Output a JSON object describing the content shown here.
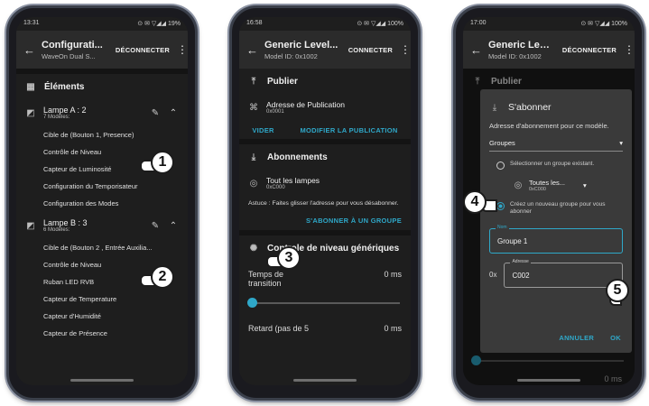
{
  "phone1": {
    "status": {
      "time": "13:31",
      "right": "⊙ ✉ ▽◢◢ 19%"
    },
    "appbar": {
      "title": "Configurati...",
      "subtitle": "WaveOn Dual S...",
      "action": "DÉCONNECTER"
    },
    "elements_title": "Éléments",
    "lampA": {
      "name": "Lampe A : 2",
      "sub": "7 Modèles:"
    },
    "lampA_items": [
      "Cible de (Bouton 1, Presence)",
      "Contrôle de Niveau",
      "Capteur de Luminosité",
      "Configuration du Temporisateur",
      "Configuration des Modes"
    ],
    "lampB": {
      "name": "Lampe B : 3",
      "sub": "6 Modèles:"
    },
    "lampB_items": [
      "Cible de (Bouton 2 , Entrée Auxilia...",
      "Contrôle de Niveau",
      "Ruban LED RVB",
      "Capteur de Temperature",
      "Capteur d'Humidité",
      "Capteur de Présence"
    ]
  },
  "phone2": {
    "status": {
      "time": "16:58",
      "right": "⊙ ✉ ▽◢◢ 100%"
    },
    "appbar": {
      "title": "Generic Level...",
      "subtitle": "Model ID: 0x1002",
      "action": "CONNECTER"
    },
    "publier": "Publier",
    "pub_addr": {
      "label": "Adresse de Publication",
      "value": "0x0001"
    },
    "vider": "VIDER",
    "modifier": "MODIFIER LA PUBLICATION",
    "abonnements": "Abonnements",
    "sub_item": {
      "label": "Tout les lampes",
      "value": "0xC000"
    },
    "astuce": "Astuce : Faites glisser l'adresse pour vous désabonner.",
    "subscribe_btn": "S'ABONNER À UN GROUPE",
    "controle": "Controle de niveau génériques",
    "temps": "Temps de transition",
    "temps_val": "0 ms",
    "retard": "Retard (pas de 5",
    "retard_val": "0 ms"
  },
  "phone3": {
    "status": {
      "time": "17:00",
      "right": "⊙ ✉ ▽◢◢ 100%"
    },
    "appbar": {
      "title": "Generic Level...",
      "subtitle": "Model ID: 0x1002",
      "action": "DÉCONNECTER"
    },
    "bg_publier": "Publier",
    "bg_val": "0 ms",
    "dialog": {
      "title": "S'abonner",
      "desc": "Adresse d'abonnement pour ce modèle.",
      "select_value": "Groupes",
      "radio1": "Sélectionner un groupe existant.",
      "group_name": "Toutes les...",
      "group_addr": "0xC000",
      "radio2": "Créez un nouveau groupe pour vous abonner",
      "name_label": "Nom",
      "name_value": "Groupe 1",
      "addr_prefix": "0x",
      "addr_label": "Adresse",
      "addr_value": "C002",
      "cancel": "ANNULER",
      "ok": "OK"
    }
  },
  "steps": [
    "1",
    "2",
    "3",
    "4",
    "5"
  ],
  "colors": {
    "accent": "#2fa8c9",
    "surface": "#1e1e1e",
    "dialog": "#3a3a3a"
  }
}
